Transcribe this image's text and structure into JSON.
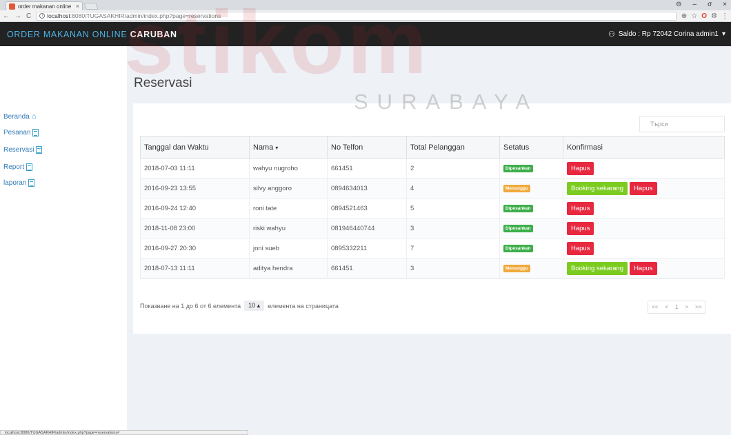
{
  "browser": {
    "tab_title": "order makanan online",
    "tab_close": "×",
    "window_controls": [
      "⊖",
      "–",
      "σ",
      "×"
    ],
    "url_host": "localhost",
    "url_path": ":8080/TUGASAKHIR/admin/index.php?page=reservations",
    "status_url": "localhost:8080/TUGASAKHIR/admin/index.php?page=reservations#"
  },
  "header": {
    "brand_prefix": "ORDER MAKANAN ONLINE",
    "brand_suffix": "CARUBAN",
    "user_label": "Saldo : Rp 72042 Corina admin1"
  },
  "sidebar": {
    "items": [
      {
        "label": "Beranda"
      },
      {
        "label": "Pesanan"
      },
      {
        "label": "Reservasi"
      },
      {
        "label": "Report"
      },
      {
        "label": "laporan"
      }
    ]
  },
  "main": {
    "title": "Reservasi",
    "search_placeholder": "Търси",
    "columns": [
      "Tanggal dan Waktu",
      "Nama",
      "No Telfon",
      "Total Pelanggan",
      "Setatus",
      "Konfirmasi"
    ],
    "rows": [
      {
        "date": "2018-07-03 11:11",
        "name": "wahyu nugroho",
        "phone": "661451",
        "total": "2",
        "status": "Dipesankan",
        "status_type": "ok",
        "book": ""
      },
      {
        "date": "2016-09-23 13:55",
        "name": "silvy anggoro",
        "phone": "0894634013",
        "total": "4",
        "status": "Menunggu",
        "status_type": "wait",
        "book": "Booking sekarang"
      },
      {
        "date": "2016-09-24 12:40",
        "name": "roni tate",
        "phone": "0894521463",
        "total": "5",
        "status": "Dipesankan",
        "status_type": "ok",
        "book": ""
      },
      {
        "date": "2018-11-08 23:00",
        "name": "riski wahyu",
        "phone": "081946440744",
        "total": "3",
        "status": "Dipesankan",
        "status_type": "ok",
        "book": ""
      },
      {
        "date": "2016-09-27 20:30",
        "name": "joni sueb",
        "phone": "0895332211",
        "total": "7",
        "status": "Dipesankan",
        "status_type": "ok",
        "book": ""
      },
      {
        "date": "2018-07-13 11:11",
        "name": "aditya hendra",
        "phone": "661451",
        "total": "3",
        "status": "Menunggu",
        "status_type": "wait",
        "book": "Booking sekarang"
      }
    ],
    "delete_label": "Hapus",
    "info_text": "Показване на 1 до 6 от 6 елемента",
    "page_size": "10",
    "page_size_suffix": "елемента на страницата",
    "pager": [
      "<<",
      "<",
      "1",
      ">",
      ">>"
    ]
  },
  "watermark": {
    "big": "stikom",
    "small": "SURABAYA"
  }
}
